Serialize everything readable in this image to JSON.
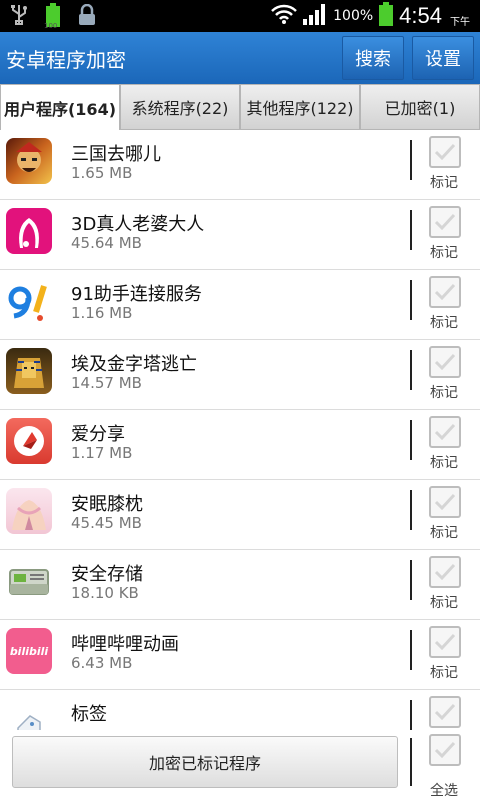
{
  "statusbar": {
    "battery_small": "100",
    "battery_percent": "100%",
    "time": "4:54",
    "ampm": "下午"
  },
  "app": {
    "title": "安卓程序加密",
    "search_label": "搜索",
    "settings_label": "设置"
  },
  "tabs": [
    {
      "label": "用户程序(164)",
      "active": true
    },
    {
      "label": "系统程序(22)",
      "active": false
    },
    {
      "label": "其他程序(122)",
      "active": false
    },
    {
      "label": "已加密(1)",
      "active": false
    }
  ],
  "apps": [
    {
      "name": " 三国去哪儿",
      "size": "1.65 MB",
      "mark": "标记",
      "icon": "sanguo-icon"
    },
    {
      "name": "3D真人老婆大人",
      "size": "45.64 MB",
      "mark": "标记",
      "icon": "laopo-icon"
    },
    {
      "name": "91助手连接服务",
      "size": "1.16 MB",
      "mark": "标记",
      "icon": "91-assistant-icon"
    },
    {
      "name": "埃及金字塔逃亡",
      "size": "14.57 MB",
      "mark": "标记",
      "icon": "pharaoh-icon"
    },
    {
      "name": "爱分享",
      "size": "1.17 MB",
      "mark": "标记",
      "icon": "aifenxiang-icon"
    },
    {
      "name": "安眠膝枕",
      "size": "45.45 MB",
      "mark": "标记",
      "icon": "anmian-icon"
    },
    {
      "name": "安全存储",
      "size": "18.10 KB",
      "mark": "标记",
      "icon": "storage-icon"
    },
    {
      "name": "哔哩哔哩动画",
      "size": "6.43 MB",
      "mark": "标记",
      "icon": "bilibili-icon"
    },
    {
      "name": "标签",
      "size": "",
      "mark": "",
      "icon": "tag-icon"
    }
  ],
  "bilibili_logo_text": "bilibili",
  "bottom": {
    "encrypt_label": "加密已标记程序",
    "select_all_label": "全选"
  },
  "colors": {
    "titlebar": "#1b67b9",
    "status_battery": "#4ccc2d"
  }
}
